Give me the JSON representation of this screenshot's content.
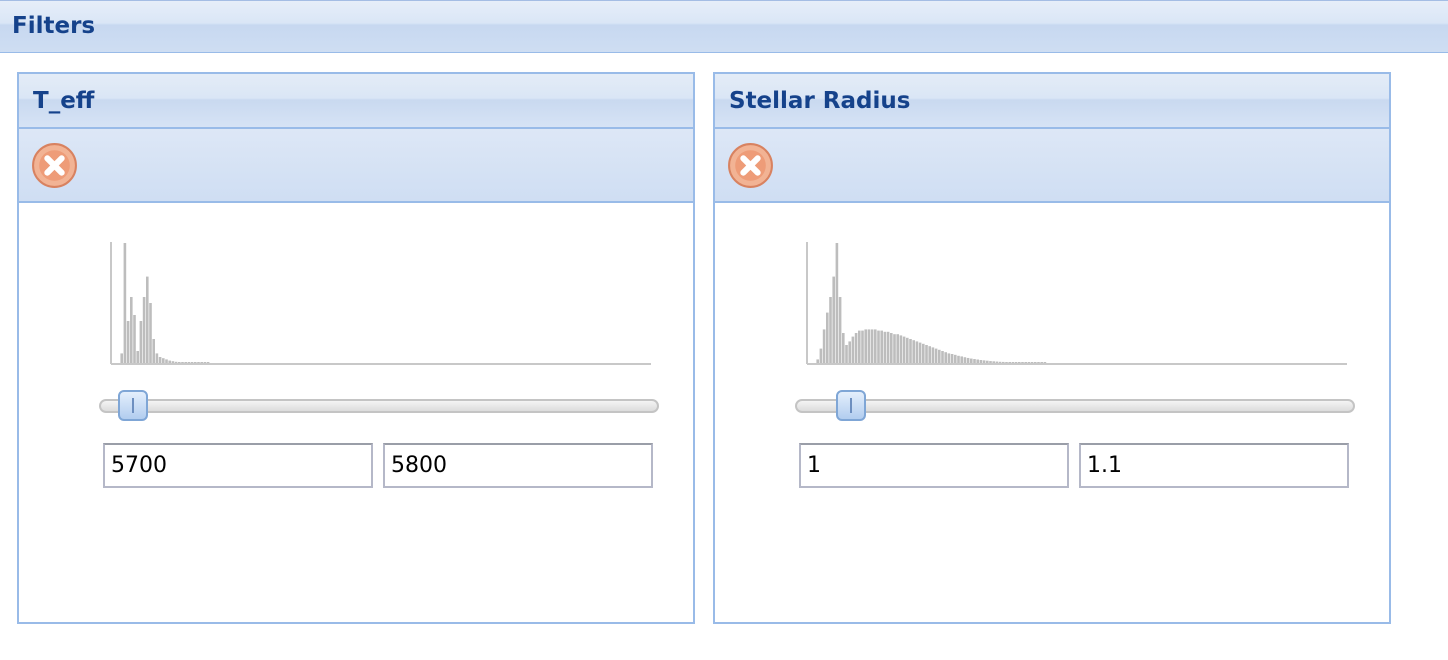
{
  "header": {
    "title": "Filters"
  },
  "colors": {
    "header_text": "#15428b",
    "border": "#99bbe8",
    "histogram_bar": "#bdbdbd",
    "remove_icon": "#f0a27c"
  },
  "filters": [
    {
      "title": "T_eff",
      "remove_icon": "remove-circle-x-icon",
      "min_value": "5700",
      "max_value": "5800",
      "slider_range": [
        0.06,
        0.06
      ],
      "histogram": [
        0,
        0,
        0.08,
        1.0,
        0.35,
        0.55,
        0.4,
        0.1,
        0.35,
        0.55,
        0.72,
        0.5,
        0.2,
        0.08,
        0.05,
        0.04,
        0.03,
        0.02,
        0.015,
        0.01,
        0.008,
        0.005,
        0.004,
        0.003,
        0.002,
        0.002,
        0.001,
        0.001,
        0.001,
        0.001
      ]
    },
    {
      "title": "Stellar Radius",
      "remove_icon": "remove-circle-x-icon",
      "min_value": "1",
      "max_value": "1.1",
      "slider_range": [
        0.1,
        0.1
      ],
      "histogram": [
        0,
        0,
        0.03,
        0.12,
        0.28,
        0.42,
        0.55,
        0.72,
        1.0,
        0.55,
        0.25,
        0.15,
        0.18,
        0.22,
        0.25,
        0.27,
        0.27,
        0.28,
        0.28,
        0.28,
        0.28,
        0.27,
        0.27,
        0.26,
        0.26,
        0.25,
        0.24,
        0.24,
        0.23,
        0.22,
        0.21,
        0.2,
        0.19,
        0.18,
        0.17,
        0.16,
        0.15,
        0.14,
        0.13,
        0.12,
        0.11,
        0.1,
        0.09,
        0.08,
        0.075,
        0.068,
        0.06,
        0.055,
        0.048,
        0.042,
        0.037,
        0.033,
        0.029,
        0.025,
        0.022,
        0.019,
        0.016,
        0.014,
        0.012,
        0.01,
        0.009,
        0.008,
        0.007,
        0.006,
        0.005,
        0.004,
        0.0035,
        0.003,
        0.0025,
        0.002,
        0.0015,
        0.001,
        0.001,
        0.001
      ]
    }
  ]
}
